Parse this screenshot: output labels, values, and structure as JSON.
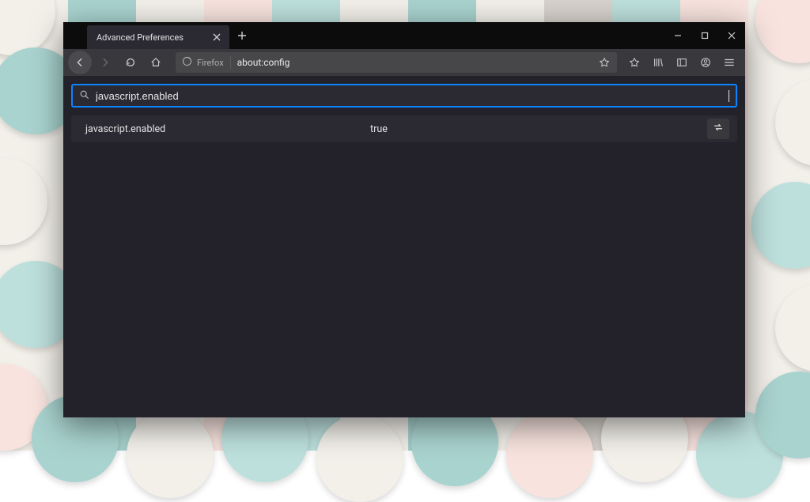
{
  "tab": {
    "title": "Advanced Preferences"
  },
  "urlbar": {
    "identity_label": "Firefox",
    "url": "about:config"
  },
  "search": {
    "value": "javascript.enabled"
  },
  "pref": {
    "name": "javascript.enabled",
    "value": "true"
  }
}
